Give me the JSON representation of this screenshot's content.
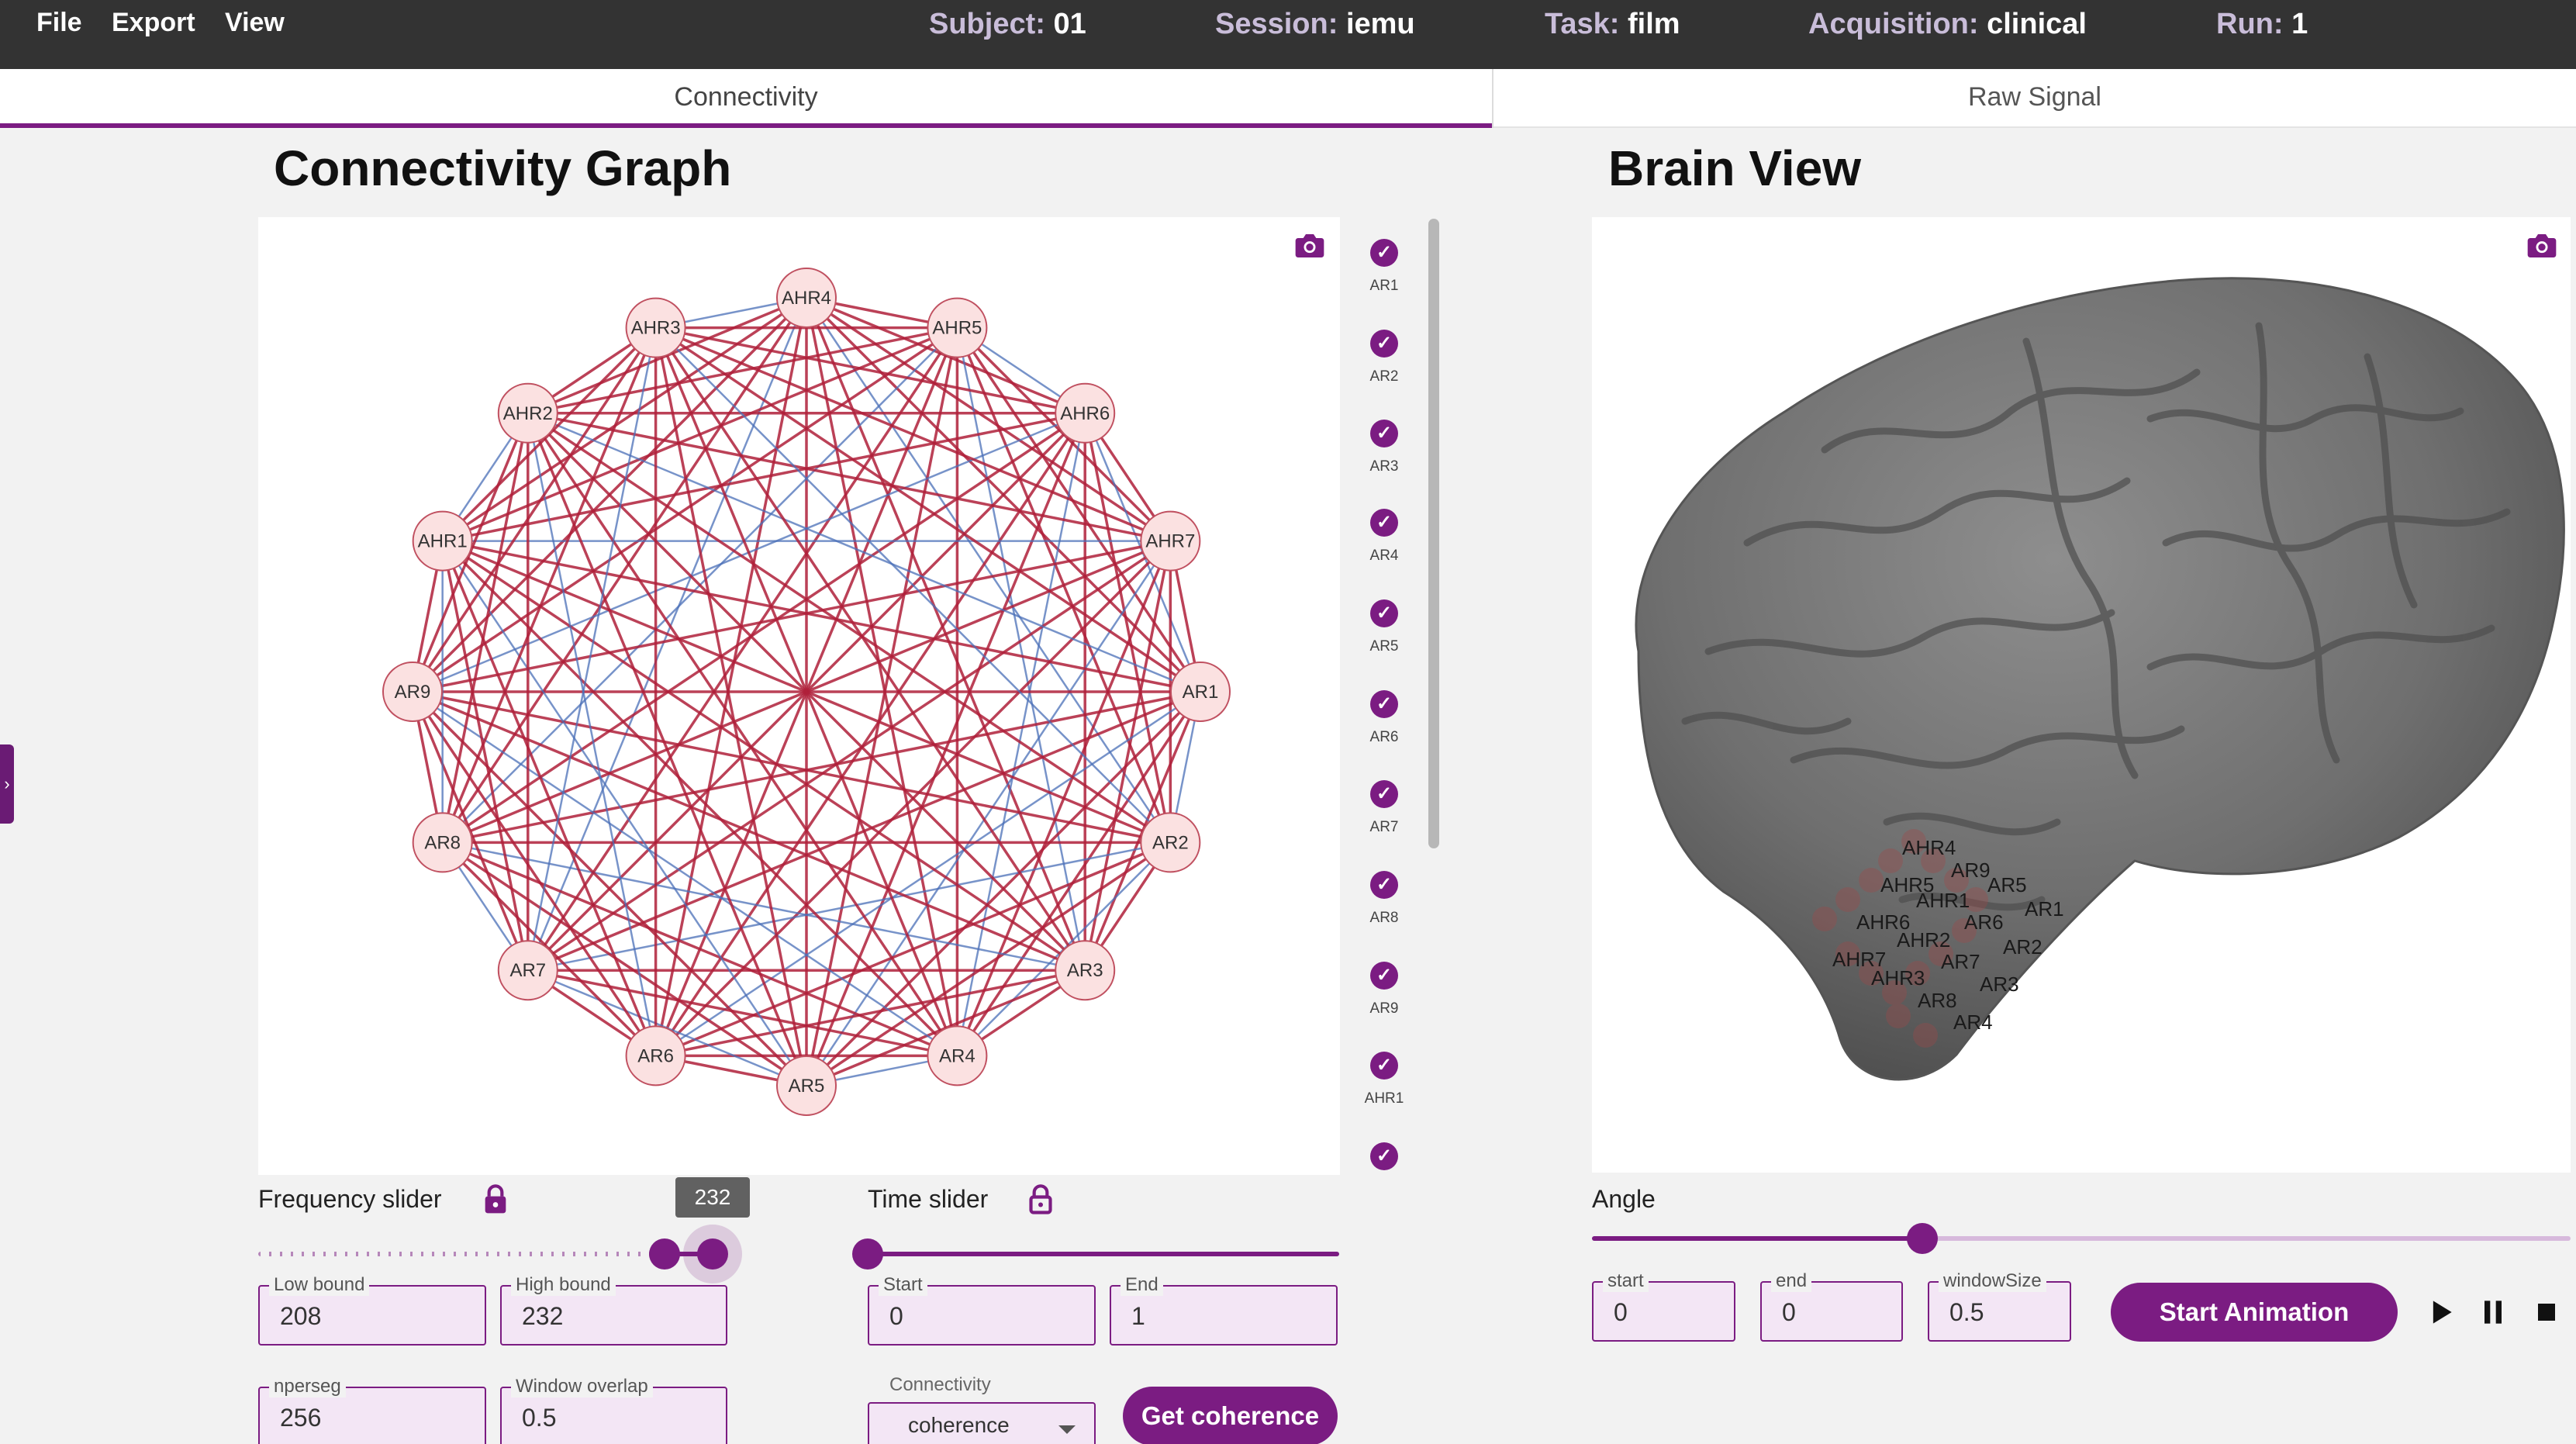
{
  "menu": {
    "file": "File",
    "export": "Export",
    "view": "View"
  },
  "meta": [
    {
      "key": "Subject:",
      "value": "01"
    },
    {
      "key": "Session:",
      "value": "iemu"
    },
    {
      "key": "Task:",
      "value": "film"
    },
    {
      "key": "Acquisition:",
      "value": "clinical"
    },
    {
      "key": "Run:",
      "value": "1"
    }
  ],
  "tabs": {
    "connectivity": "Connectivity",
    "raw_signal": "Raw Signal"
  },
  "connectivity_graph": {
    "title": "Connectivity Graph",
    "nodes": [
      "AHR4",
      "AHR5",
      "AHR6",
      "AHR7",
      "AR1",
      "AR2",
      "AR3",
      "AR4",
      "AR5",
      "AR6",
      "AR7",
      "AR8",
      "AR9",
      "AHR1",
      "AHR2",
      "AHR3"
    ],
    "edge_colors": {
      "strong": "#b0203a",
      "weak": "#4a6fb8"
    },
    "node_fill": "#fbe1e1",
    "node_stroke": "#c05060"
  },
  "legend": [
    "AR1",
    "AR2",
    "AR3",
    "AR4",
    "AR5",
    "AR6",
    "AR7",
    "AR8",
    "AR9",
    "AHR1",
    ""
  ],
  "brain_view": {
    "title": "Brain View",
    "electrodes": [
      "AHR4",
      "AR9",
      "AHR5",
      "AR5",
      "AHR1",
      "AR1",
      "AHR6",
      "AR6",
      "AHR2",
      "AR2",
      "AHR7",
      "AR7",
      "AHR3",
      "AR3",
      "AR8",
      "AR4"
    ]
  },
  "frequency": {
    "label": "Frequency slider",
    "tooltip": "232",
    "low_bound_label": "Low bound",
    "low_bound": "208",
    "high_bound_label": "High bound",
    "high_bound": "232",
    "nperseg_label": "nperseg",
    "nperseg": "256",
    "window_overlap_label": "Window overlap",
    "window_overlap": "0.5"
  },
  "time": {
    "label": "Time slider",
    "start_label": "Start",
    "start": "0",
    "end_label": "End",
    "end": "1",
    "connectivity_label": "Connectivity",
    "connectivity_value": "coherence",
    "get_coherence": "Get coherence"
  },
  "angle": {
    "label": "Angle",
    "start_label": "start",
    "start": "0",
    "end_label": "end",
    "end": "0",
    "window_label": "windowSize",
    "window": "0.5",
    "start_animation": "Start Animation"
  },
  "colors": {
    "accent": "#7b1c82",
    "topbar": "#333333"
  }
}
